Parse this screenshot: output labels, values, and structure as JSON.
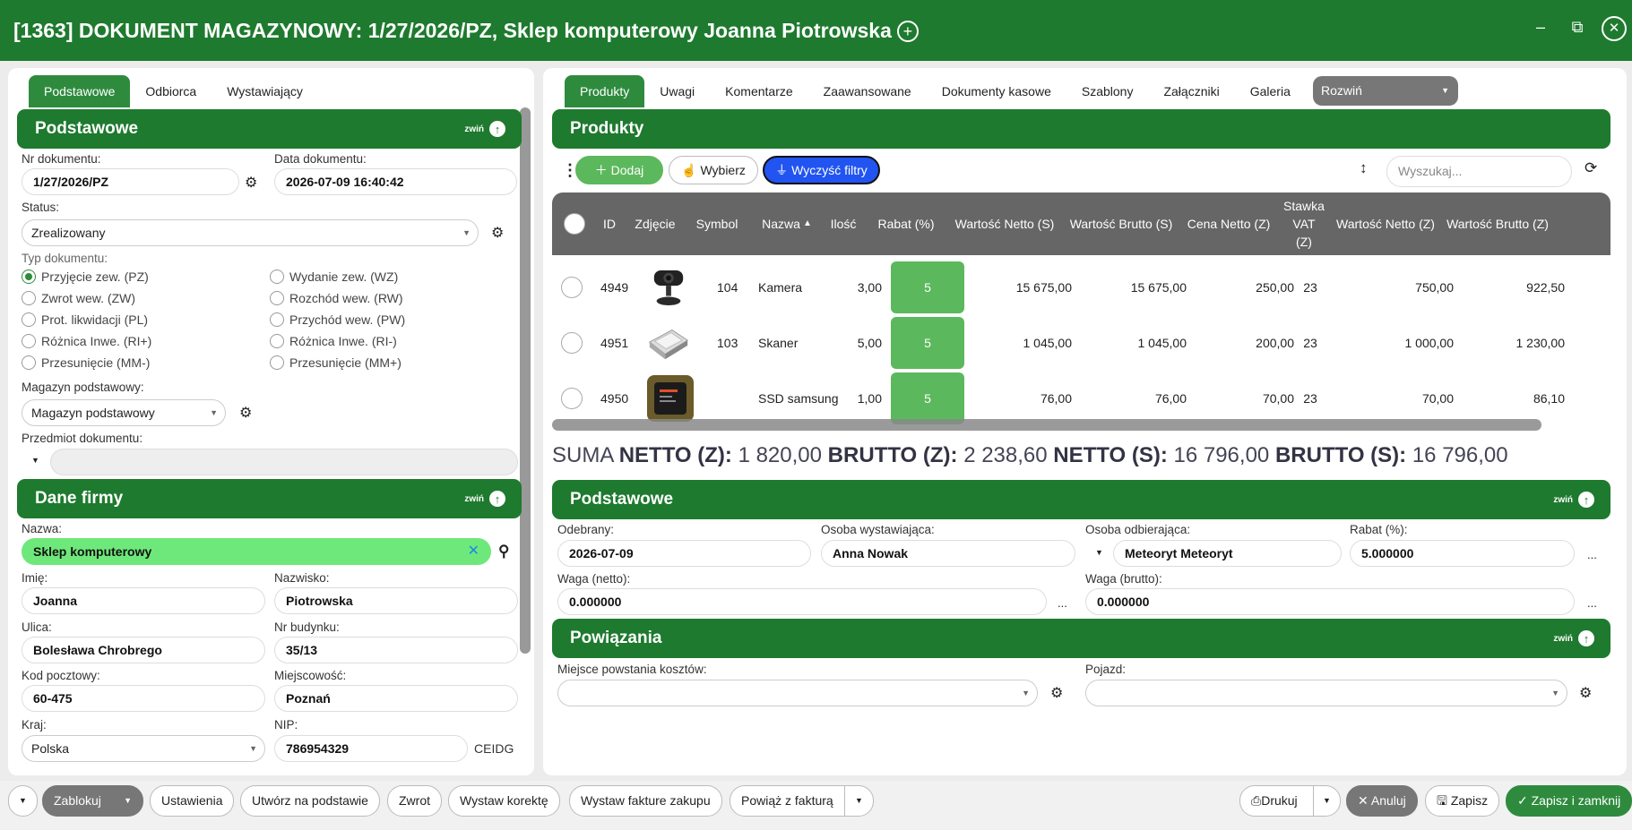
{
  "window": {
    "title": "[1363] DOKUMENT MAGAZYNOWY: 1/27/2026/PZ, Sklep komputerowy Joanna Piotrowska",
    "add_glyph": "+",
    "minimize": "‒",
    "restore": "⧉",
    "close": "✕"
  },
  "colors": {
    "primary": "#1e7a2e",
    "accent_tab": "#2e8b3e",
    "add_button": "#5cb85c",
    "filter_button": "#2154f0",
    "selected_input": "#6ee87a"
  },
  "left_tabs": [
    "Podstawowe",
    "Odbiorca",
    "Wystawiający"
  ],
  "right_tabs": [
    "Produkty",
    "Uwagi",
    "Komentarze",
    "Zaawansowane",
    "Dokumenty kasowe",
    "Szablony",
    "Załączniki",
    "Galeria"
  ],
  "expand_select": "Rozwiń",
  "collapse_label": "zwiń",
  "basic_section": {
    "title": "Podstawowe",
    "nr_label": "Nr dokumentu:",
    "nr_value": "1/27/2026/PZ",
    "date_label": "Data dokumentu:",
    "date_value": "2026-07-09 16:40:42",
    "status_label": "Status:",
    "status_value": "Zrealizowany",
    "type_label": "Typ dokumentu:",
    "types": [
      "Przyjęcie zew. (PZ)",
      "Wydanie zew. (WZ)",
      "Zwrot wew. (ZW)",
      "Rozchód wew. (RW)",
      "Prot. likwidacji (PL)",
      "Przychód wew. (PW)",
      "Różnica Inwe. (RI+)",
      "Różnica Inwe. (RI-)",
      "Przesunięcie (MM-)",
      "Przesunięcie (MM+)"
    ],
    "selected_type": "Przyjęcie zew. (PZ)",
    "warehouse_label": "Magazyn podstawowy:",
    "warehouse_value": "Magazyn podstawowy",
    "subject_label": "Przedmiot dokumentu:",
    "subject_value": ""
  },
  "company": {
    "title": "Dane firmy",
    "name_label": "Nazwa:",
    "name_value": "Sklep komputerowy",
    "first_label": "Imię:",
    "first_value": "Joanna",
    "last_label": "Nazwisko:",
    "last_value": "Piotrowska",
    "street_label": "Ulica:",
    "street_value": "Bolesława Chrobrego",
    "bldg_label": "Nr budynku:",
    "bldg_value": "35/13",
    "zip_label": "Kod pocztowy:",
    "zip_value": "60-475",
    "city_label": "Miejscowość:",
    "city_value": "Poznań",
    "country_label": "Kraj:",
    "country_value": "Polska",
    "nip_label": "NIP:",
    "nip_value": "786954329",
    "ceidg": "CEIDG"
  },
  "products": {
    "title": "Produkty",
    "add": "Dodaj",
    "choose": "Wybierz",
    "clear_filters": "Wyczyść filtry",
    "search_placeholder": "Wyszukaj...",
    "columns": [
      "ID",
      "Zdjęcie",
      "Symbol",
      "Nazwa",
      "Ilość",
      "Rabat (%)",
      "Wartość Netto (S)",
      "Wartość Brutto (S)",
      "Cena Netto (Z)",
      "Stawka VAT (Z)",
      "Wartość Netto (Z)",
      "Wartość Brutto (Z)"
    ],
    "sort_glyph": "▲",
    "rows": [
      {
        "id": "4949",
        "image": "webcam-photo",
        "symbol": "104",
        "name": "Kamera",
        "qty": "3,00",
        "discount": "5",
        "net_s": "15 675,00",
        "gross_s": "15 675,00",
        "price_net_z": "250,00",
        "vat": "23",
        "net_z": "750,00",
        "gross_z": "922,50"
      },
      {
        "id": "4951",
        "image": "scanner-photo",
        "symbol": "103",
        "name": "Skaner",
        "qty": "5,00",
        "discount": "5",
        "net_s": "1 045,00",
        "gross_s": "1 045,00",
        "price_net_z": "200,00",
        "vat": "23",
        "net_z": "1 000,00",
        "gross_z": "1 230,00"
      },
      {
        "id": "4950",
        "image": "ssd-photo",
        "symbol": "",
        "name": "SSD samsung",
        "qty": "1,00",
        "discount": "5",
        "net_s": "76,00",
        "gross_s": "76,00",
        "price_net_z": "70,00",
        "vat": "23",
        "net_z": "70,00",
        "gross_z": "86,10"
      }
    ]
  },
  "sum": {
    "prefix": "SUMA",
    "netto_z_label": "NETTO (Z):",
    "netto_z": "1 820,00",
    "brutto_z_label": "BRUTTO (Z):",
    "brutto_z": "2 238,60",
    "netto_s_label": "NETTO (S):",
    "netto_s": "16 796,00",
    "brutto_s_label": "BRUTTO (S):",
    "brutto_s": "16 796,00"
  },
  "right_basic": {
    "title": "Podstawowe",
    "received_label": "Odebrany:",
    "received_value": "2026-07-09",
    "issuer_label": "Osoba wystawiająca:",
    "issuer_value": "Anna Nowak",
    "receiver_label": "Osoba odbierająca:",
    "receiver_value": "Meteoryt Meteoryt",
    "discount_label": "Rabat (%):",
    "discount_value": "5.000000",
    "weight_net_label": "Waga (netto):",
    "weight_net_value": "0.000000",
    "weight_gross_label": "Waga (brutto):",
    "weight_gross_value": "0.000000",
    "more": "..."
  },
  "relations": {
    "title": "Powiązania",
    "cost_label": "Miejsce powstania kosztów:",
    "vehicle_label": "Pojazd:"
  },
  "bottom": {
    "block": "Zablokuj",
    "settings": "Ustawienia",
    "create_based": "Utwórz na podstawie",
    "return": "Zwrot",
    "correction": "Wystaw korektę",
    "purchase_invoice": "Wystaw fakture zakupu",
    "link_invoice": "Powiąż z fakturą",
    "print": "Drukuj",
    "cancel": "Anuluj",
    "save": "Zapisz",
    "save_close": "Zapisz i zamknij"
  }
}
